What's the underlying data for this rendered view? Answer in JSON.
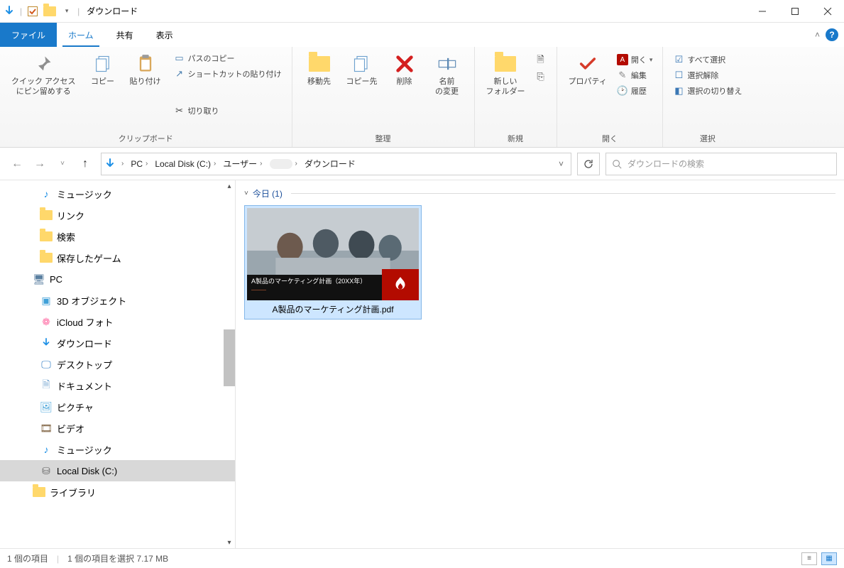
{
  "window": {
    "title": "ダウンロード"
  },
  "tabs": {
    "file": "ファイル",
    "home": "ホーム",
    "share": "共有",
    "view": "表示"
  },
  "ribbon": {
    "pin": "クイック アクセス\nにピン留めする",
    "copy": "コピー",
    "paste": "貼り付け",
    "cut": "切り取り",
    "copy_path": "パスのコピー",
    "paste_shortcut": "ショートカットの貼り付け",
    "group_clipboard": "クリップボード",
    "move_to": "移動先",
    "copy_to": "コピー先",
    "delete": "削除",
    "rename": "名前\nの変更",
    "group_organize": "整理",
    "new_folder": "新しい\nフォルダー",
    "group_new": "新規",
    "properties": "プロパティ",
    "open": "開く",
    "edit": "編集",
    "history": "履歴",
    "group_open": "開く",
    "select_all": "すべて選択",
    "select_none": "選択解除",
    "invert_selection": "選択の切り替え",
    "group_select": "選択"
  },
  "breadcrumb": {
    "pc": "PC",
    "disk": "Local Disk (C:)",
    "users": "ユーザー",
    "user": "",
    "downloads": "ダウンロード"
  },
  "search": {
    "placeholder": "ダウンロードの検索"
  },
  "sidebar": {
    "items": [
      {
        "label": "ミュージック"
      },
      {
        "label": "リンク"
      },
      {
        "label": "検索"
      },
      {
        "label": "保存したゲーム"
      },
      {
        "label": "PC"
      },
      {
        "label": "3D オブジェクト"
      },
      {
        "label": "iCloud フォト"
      },
      {
        "label": "ダウンロード"
      },
      {
        "label": "デスクトップ"
      },
      {
        "label": "ドキュメント"
      },
      {
        "label": "ピクチャ"
      },
      {
        "label": "ビデオ"
      },
      {
        "label": "ミュージック"
      },
      {
        "label": "Local Disk (C:)"
      },
      {
        "label": "ライブラリ"
      }
    ]
  },
  "content": {
    "group_header": "今日 (1)",
    "file": {
      "name": "A製品のマーケティング計画.pdf",
      "overlay": "A製品のマーケティング計画（20XX年）"
    }
  },
  "status": {
    "items": "1 個の項目",
    "selected": "1 個の項目を選択 7.17 MB"
  }
}
